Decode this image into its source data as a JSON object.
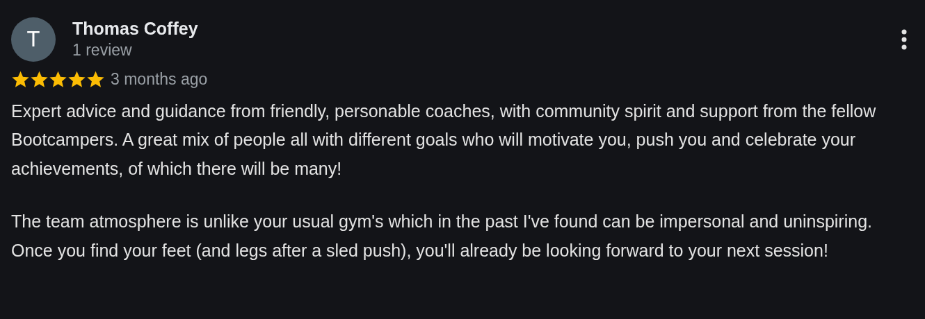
{
  "review": {
    "avatar_letter": "T",
    "author": "Thomas Coffey",
    "author_meta": "1 review",
    "stars": 5,
    "date": "3 months ago",
    "paragraphs": [
      "Expert advice and guidance from friendly, personable coaches, with community spirit and support from the fellow Bootcampers. A great mix of people all with different goals who will motivate you, push you and celebrate your achievements, of which there will be many!",
      "The team atmosphere is unlike your usual gym's which in the past I've found can be impersonal and uninspiring. Once you find your feet (and legs after a sled push), you'll already be looking forward to your next session!"
    ]
  }
}
